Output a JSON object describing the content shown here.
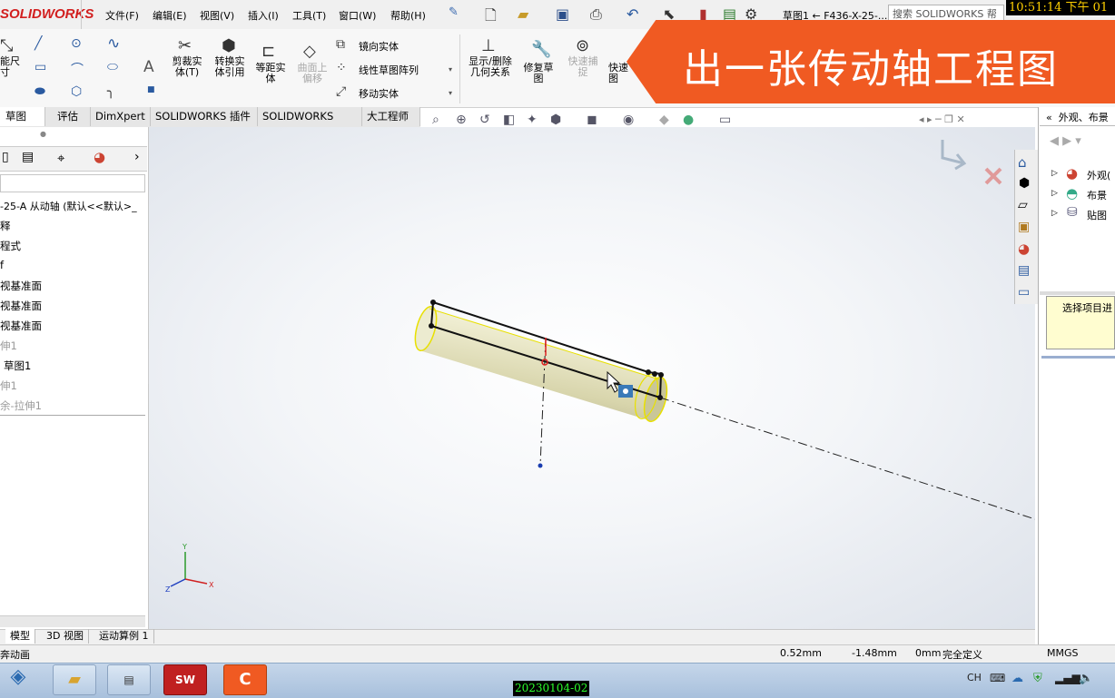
{
  "app": {
    "logo": "SOLIDWORKS",
    "doc_title": "草图1 ← F436-X-25-...",
    "search_placeholder": "搜索 SOLIDWORKS 帮",
    "clock": "10:51:14 下午 01"
  },
  "menu": [
    "文件(F)",
    "编辑(E)",
    "视图(V)",
    "插入(I)",
    "工具(T)",
    "窗口(W)",
    "帮助(H)"
  ],
  "commands": {
    "smart_dim": "能尺\n寸",
    "trim": "剪裁实\n体(T)",
    "convert": "转换实\n体引用",
    "offset": "等距实\n体",
    "surface_offset": "曲面上\n偏移",
    "mirror": "镜向实体",
    "linear_pattern": "线性草图阵列",
    "move": "移动实体",
    "display_relations": "显示/删除\n几何关系",
    "repair": "修复草\n图",
    "quick_snap": "快速捕\n捉",
    "quick_view": "快速\n图"
  },
  "banner_text": "出一张传动轴工程图",
  "tabs": [
    "草图",
    "评估",
    "DimXpert",
    "SOLIDWORKS 插件",
    "SOLIDWORKS MBD",
    "大工程师"
  ],
  "feature_tree": {
    "root": "-25-A 从动轴  (默认<<默认>_",
    "items": [
      "释",
      "程式",
      "f",
      "视基准面",
      "视基准面",
      "视基准面",
      "伸1",
      "草图1",
      "伸1",
      "余-拉伸1"
    ],
    "grey_items": [
      6,
      8,
      9
    ]
  },
  "task_pane": {
    "header": "外观、布景",
    "items": [
      "外观(",
      "布景",
      "贴图"
    ],
    "hint": "选择项目进"
  },
  "bottom_tabs": [
    "模型",
    "3D 视图",
    "运动算例 1"
  ],
  "status": {
    "left": "奔动画",
    "x": "0.52mm",
    "y": "-1.48mm",
    "z": "0mm",
    "state": "完全定义",
    "units": "MMGS"
  },
  "taskbar": {
    "date_stamp": "20230104-02",
    "lang": "CH"
  },
  "colors": {
    "banner": "#f05a22",
    "logo": "#d21f1f",
    "shaft_edge": "#e8e000",
    "clock_fg": "#ffd000",
    "date_fg": "#2cff2c"
  }
}
